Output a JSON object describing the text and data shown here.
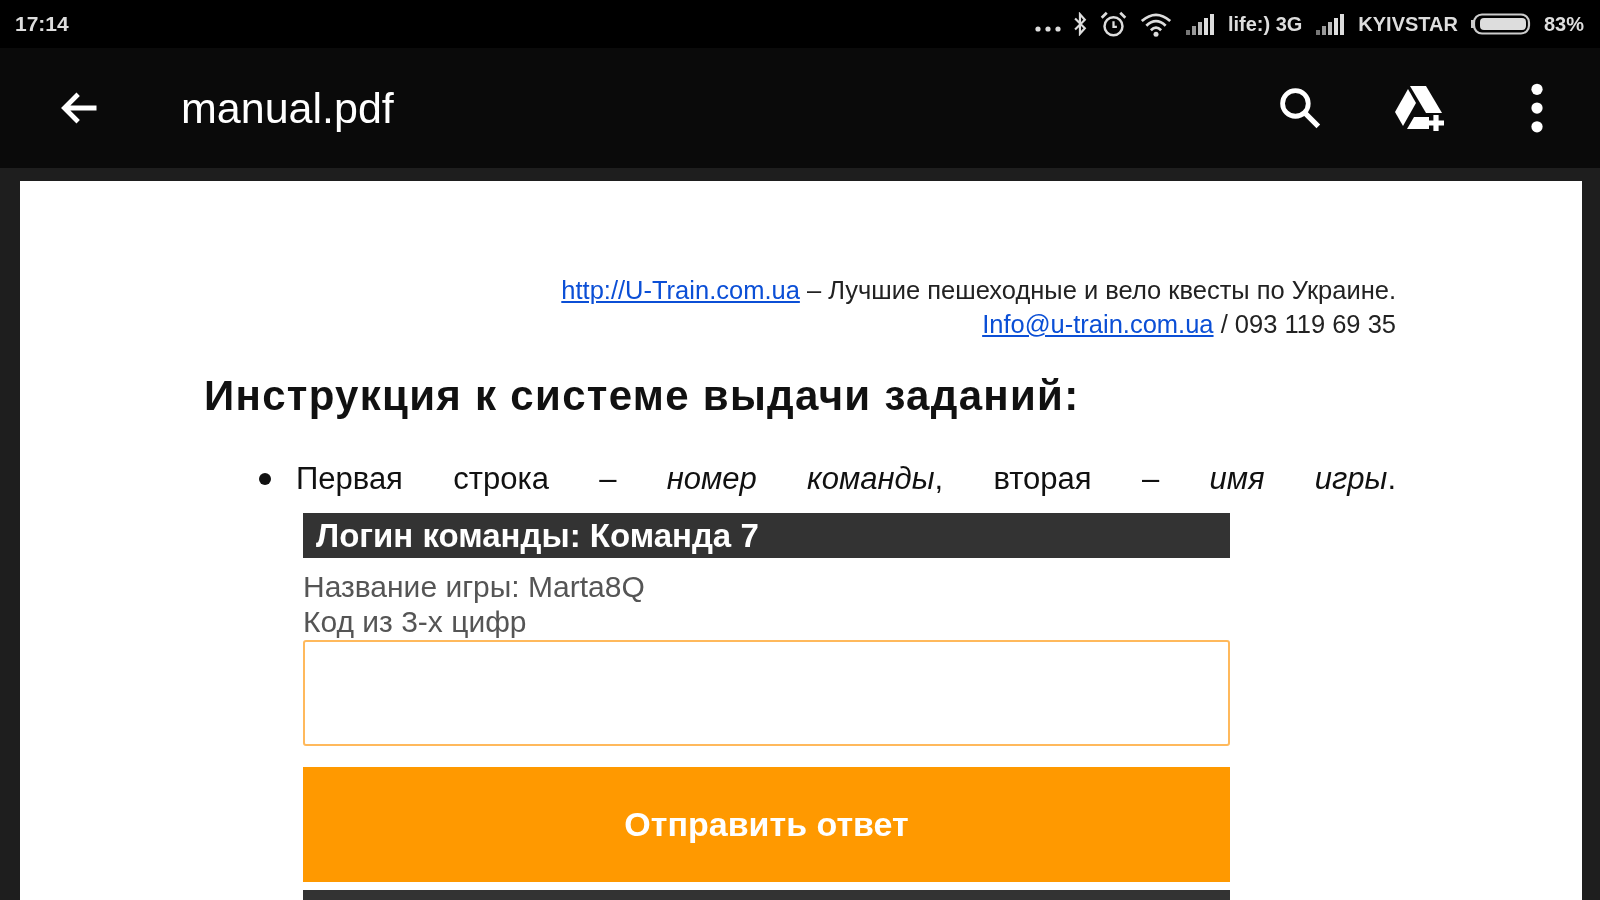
{
  "status_bar": {
    "time": "17:14",
    "carrier_1": "life:) 3G",
    "carrier_2": "KYIVSTAR",
    "battery": "83%"
  },
  "toolbar": {
    "title": "manual.pdf"
  },
  "document": {
    "website_link": "http://U-Train.com.ua",
    "tagline": "– Лучшие пешеходные и вело квесты по Украине.",
    "email_link": "Info@u-train.com.ua",
    "phone": "/ 093 119 69 35",
    "heading": "Инструкция к системе выдачи заданий:",
    "bullets": [
      "Первая строка – *номер команды*, вторая – *имя игры*."
    ],
    "embedded_form": {
      "login_bar": "Логин команды: Команда 7",
      "game_name": "Название игры: Marta8Q",
      "code_label": "Код из 3-х цифр",
      "submit_button": "Отправить ответ"
    }
  }
}
